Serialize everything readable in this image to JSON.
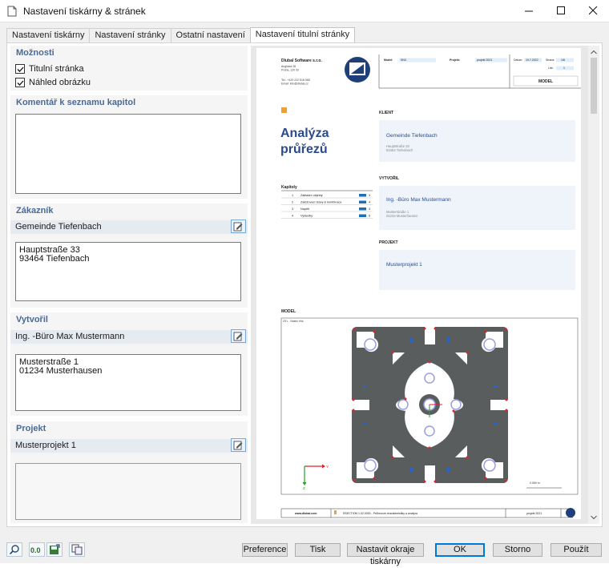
{
  "window": {
    "title": "Nastavení tiskárny & stránek"
  },
  "tabs": [
    {
      "label": "Nastavení tiskárny",
      "active": false
    },
    {
      "label": "Nastavení stránky",
      "active": false
    },
    {
      "label": "Ostatní nastavení",
      "active": false
    },
    {
      "label": "Nastavení titulní stránky",
      "active": true
    }
  ],
  "options": {
    "title": "Možnosti",
    "items": [
      {
        "label": "Titulní stránka",
        "checked": true
      },
      {
        "label": "Náhled obrázku",
        "checked": true
      }
    ]
  },
  "comment": {
    "title": "Komentář k seznamu kapitol",
    "value": ""
  },
  "customer": {
    "title": "Zákazník",
    "name": "Gemeinde Tiefenbach",
    "address": "Hauptstraße 33\n93464 Tiefenbach"
  },
  "author": {
    "title": "Vytvořil",
    "name": "Ing. -Büro Max Mustermann",
    "address": "Musterstraße 1\n01234 Musterhausen"
  },
  "project": {
    "title": "Projekt",
    "name": "Musterprojekt 1",
    "description": ""
  },
  "preview": {
    "company": "Dlubal Software s.r.o.",
    "company_lines": [
      "Anglická 28",
      "Praha, 120 00"
    ],
    "contact_lines": [
      "Tel.: +420 222 518 568",
      "Email: info@dlubal.cz"
    ],
    "model_label": "Model:",
    "model_value": "SN3",
    "project_label": "Projekt:",
    "project_value": "projekt 2021",
    "date_label": "Datum:",
    "date_value": "19.7.2022",
    "page_label": "Strana:",
    "page_value": "1/8",
    "sheet_label": "List:",
    "sheet_value": "1",
    "model_box": "MODEL",
    "doc_title": "Analýza průřezů",
    "client_head": "KLIENT",
    "client_name": "Gemeinde Tiefenbach",
    "client_addr": [
      "Hauptstraße 33",
      "93464 Tiefenbach"
    ],
    "author_head": "VYTVOŘIL",
    "author_name": "Ing. -Büro Max Mustermann",
    "author_addr": [
      "Musterstraße 1",
      "01234 Musterhausen"
    ],
    "project_head": "PROJEKT",
    "project_name": "Musterprojekt 1",
    "chapters_head": "Kapitoly",
    "chapters": [
      {
        "num": "1",
        "name": "Základní objekty",
        "page": "3"
      },
      {
        "num": "2",
        "name": "Zatěžovací stavy & kombinace",
        "page": "4"
      },
      {
        "num": "3",
        "name": "Napětí",
        "page": "4"
      },
      {
        "num": "4",
        "name": "Výsledky",
        "page": "5"
      }
    ],
    "model_head": "MODEL",
    "model_caption": "ZS1 - Vlastní tíha",
    "axis_y": "Y",
    "axis_z": "Z",
    "scale": "0.059 m",
    "footer_site": "www.dlubal.com",
    "footer_text": "RSECTION 1.02.0000 - Průřezové charakteristiky a analýza",
    "footer_project": "projekt 2021"
  },
  "buttons": {
    "preference": "Preference",
    "print": "Tisk",
    "margins": "Nastavit okraje tiskárny",
    "ok": "OK",
    "cancel": "Storno",
    "apply": "Použít"
  },
  "colors": {
    "accent": "#4a6a96",
    "title_blue": "#2b4a8c",
    "orange": "#f0a030",
    "panel": "#f5f5f5"
  }
}
